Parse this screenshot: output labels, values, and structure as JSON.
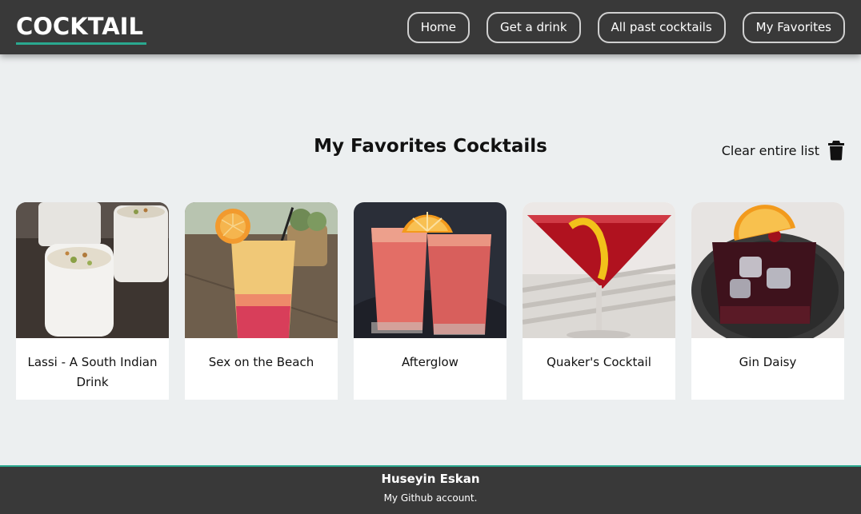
{
  "brand": "COCKTAIL",
  "nav": {
    "home": "Home",
    "get_drink": "Get a drink",
    "past": "All past cocktails",
    "favorites": "My Favorites"
  },
  "page": {
    "title": "My Favorites Cocktails",
    "clear_label": "Clear entire list"
  },
  "cards": [
    {
      "name": "Lassi - A South Indian Drink",
      "image": "lassi glasses"
    },
    {
      "name": "Sex on the Beach",
      "image": "orange-red tall glass"
    },
    {
      "name": "Afterglow",
      "image": "two pink glasses with orange"
    },
    {
      "name": "Quaker's Cocktail",
      "image": "red martini with lemon twist"
    },
    {
      "name": "Gin Daisy",
      "image": "dark red drink with ice and orange"
    }
  ],
  "footer": {
    "name": "Huseyin Eskan",
    "link": "My Github account."
  },
  "colors": {
    "navbar": "#393939",
    "accent": "#2aa88f",
    "background": "#eceff0"
  }
}
